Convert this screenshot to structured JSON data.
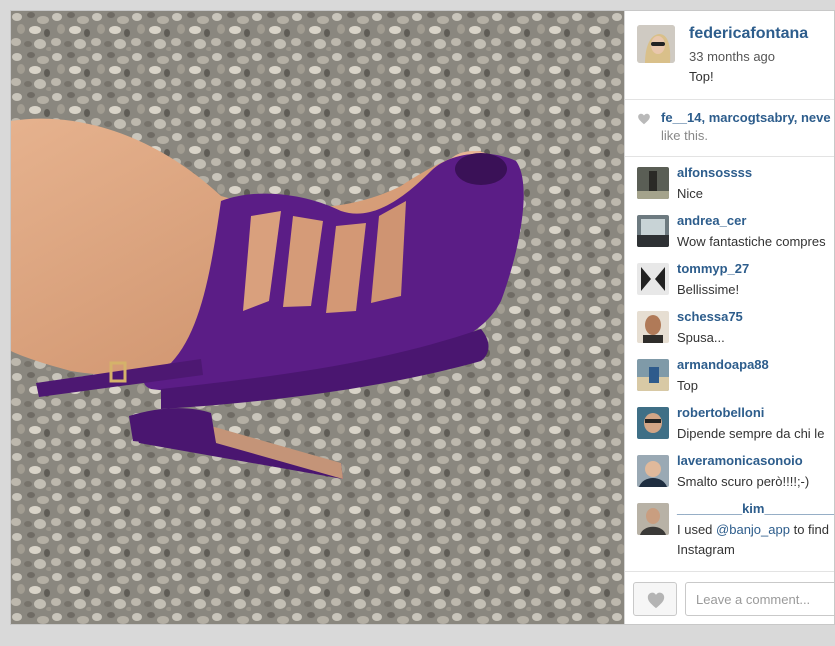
{
  "post": {
    "username": "federicafontana",
    "time": "33 months ago",
    "caption": "Top!"
  },
  "likes": {
    "users": "fe__14, marcogtsabry, neve",
    "suffix": "like this."
  },
  "comments": [
    {
      "user": "alfonsossss",
      "text": "Nice"
    },
    {
      "user": "andrea_cer",
      "text": "Wow fantastiche compres"
    },
    {
      "user": "tommyp_27",
      "text": "Bellissime!"
    },
    {
      "user": "schessa75",
      "text": "Spusa..."
    },
    {
      "user": "armandoapa88",
      "text": "Top"
    },
    {
      "user": "robertobelloni",
      "text": "Dipende sempre da chi le"
    },
    {
      "user": "laveramonicasonoio",
      "text": "Smalto scuro però!!!!;-)"
    },
    {
      "user": "_________kim__________",
      "text_pre": "I used ",
      "mention": "@banjo_app",
      "text_post": " to find",
      "text_line2": "Instagram"
    }
  ],
  "footer": {
    "comment_placeholder": "Leave a comment..."
  },
  "colors": {
    "link": "#2d5d8c",
    "shoe": "#5b1d86"
  },
  "icons": {
    "likes": "heart-icon",
    "like_button": "heart-icon"
  }
}
